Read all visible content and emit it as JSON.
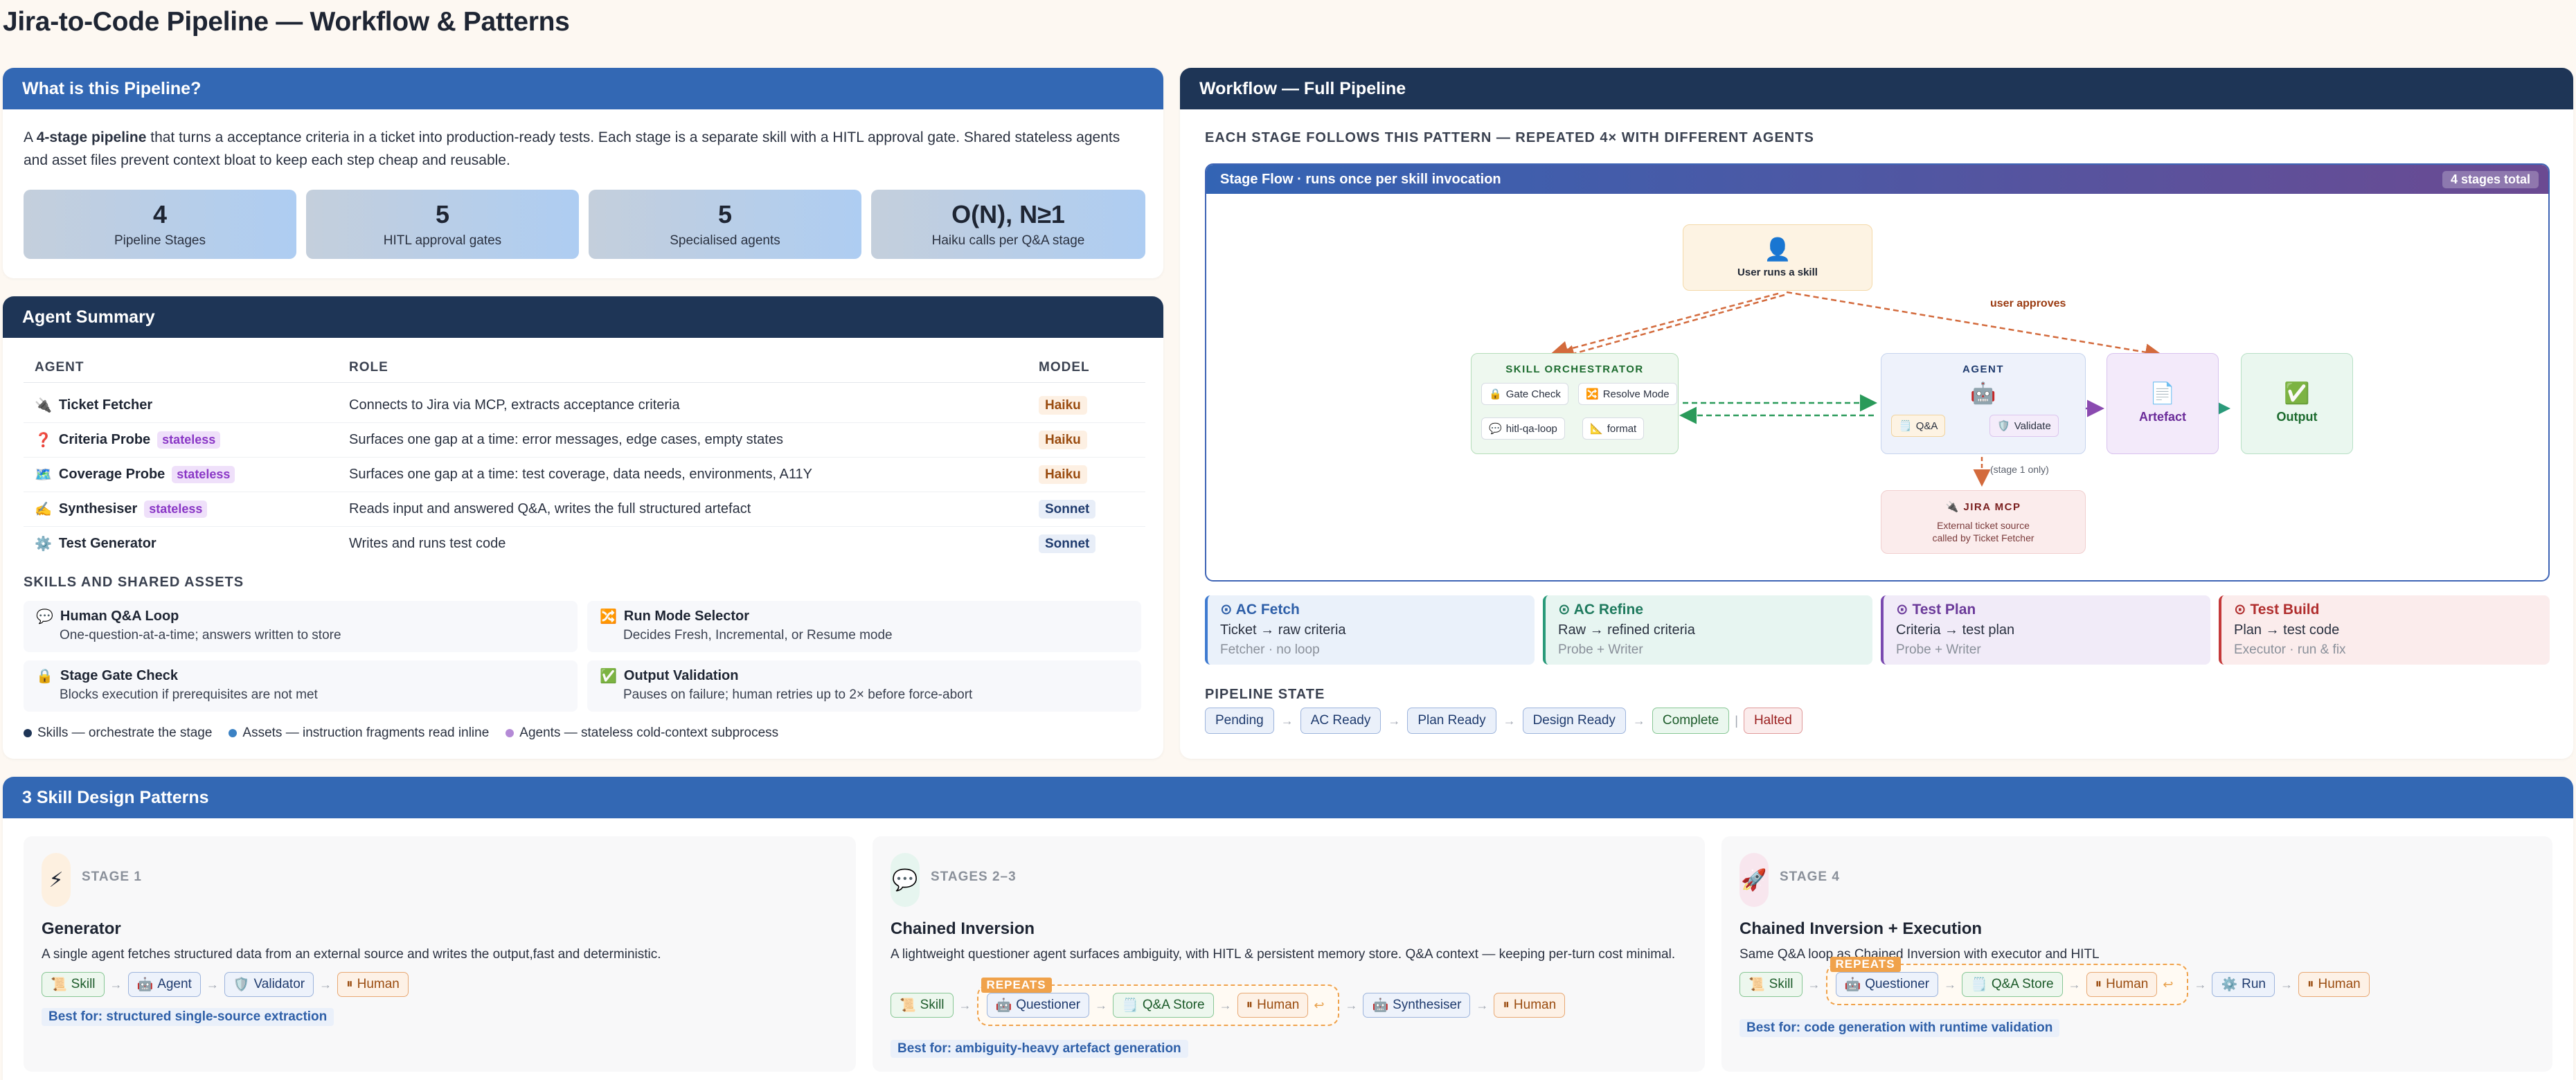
{
  "page_title": "Jira-to-Code Pipeline — Workflow & Patterns",
  "intro": {
    "header": "What is this Pipeline?",
    "lead_pre": "A ",
    "lead_bold": "4-stage pipeline",
    "lead_post": " that turns a acceptance criteria in a ticket into production-ready tests. Each stage is a separate skill with a HITL approval gate. Shared stateless agents and asset files prevent context bloat to keep each step cheap and reusable.",
    "stats": [
      {
        "num": "4",
        "label": "Pipeline Stages"
      },
      {
        "num": "5",
        "label": "HITL approval gates"
      },
      {
        "num": "5",
        "label": "Specialised agents"
      },
      {
        "num": "O(N), N≥1",
        "label": "Haiku calls per Q&A stage"
      }
    ]
  },
  "agents": {
    "header": "Agent Summary",
    "columns": [
      "AGENT",
      "ROLE",
      "MODEL"
    ],
    "rows": [
      {
        "icon": "🔌",
        "name": "Ticket Fetcher",
        "tag": "",
        "role": "Connects to Jira via MCP, extracts acceptance criteria",
        "model": "Haiku"
      },
      {
        "icon": "❓",
        "name": "Criteria Probe",
        "tag": "stateless",
        "role": "Surfaces one gap at a time: error messages, edge cases, empty states",
        "model": "Haiku"
      },
      {
        "icon": "🗺️",
        "name": "Coverage Probe",
        "tag": "stateless",
        "role": "Surfaces one gap at a time: test coverage, data needs, environments, A11Y",
        "model": "Haiku"
      },
      {
        "icon": "✍️",
        "name": "Synthesiser",
        "tag": "stateless",
        "role": "Reads input and answered Q&A, writes the full structured artefact",
        "model": "Sonnet"
      },
      {
        "icon": "⚙️",
        "name": "Test Generator",
        "tag": "",
        "role": "Writes and runs test code",
        "model": "Sonnet"
      }
    ],
    "skills_label": "SKILLS AND SHARED ASSETS",
    "assets": [
      {
        "icon": "💬",
        "title": "Human Q&A Loop",
        "desc": "One-question-at-a-time; answers written to store"
      },
      {
        "icon": "🔀",
        "title": "Run Mode Selector",
        "desc": "Decides Fresh, Incremental, or Resume mode"
      },
      {
        "icon": "🔒",
        "title": "Stage Gate Check",
        "desc": "Blocks execution if prerequisites are not met"
      },
      {
        "icon": "✅",
        "title": "Output Validation",
        "desc": "Pauses on failure; human retries up to 2× before force-abort"
      }
    ],
    "legend": [
      {
        "label": "Skills — orchestrate the stage",
        "color": "#1e3556"
      },
      {
        "label": "Assets — instruction fragments read inline",
        "color": "#3b82c4"
      },
      {
        "label": "Agents — stateless cold-context subprocess",
        "color": "#b48ad6"
      }
    ]
  },
  "workflow": {
    "header": "Workflow — Full Pipeline",
    "sub": "EACH STAGE FOLLOWS THIS PATTERN — REPEATED 4× WITH DIFFERENT AGENTS",
    "flow_title": "Stage Flow  ·  runs once per skill invocation",
    "flow_badge": "4 stages total",
    "user_node": "User runs a skill",
    "user_approves": "user approves",
    "orchestrator": "SKILL ORCHESTRATOR",
    "orch_chips": [
      "Gate Check",
      "Resolve Mode",
      "hitl-qa-loop",
      "format"
    ],
    "agent": "AGENT",
    "agent_chips": [
      "Q&A",
      "Validate"
    ],
    "artefact": "Artefact",
    "output": "Output",
    "stage1_only": "(stage 1 only)",
    "jira_title": "JIRA MCP",
    "jira_desc1": "External ticket source",
    "jira_desc2": "called by Ticket Fetcher",
    "stages": [
      {
        "title": "AC Fetch",
        "a": "Ticket → raw criteria",
        "b": "Fetcher · no loop"
      },
      {
        "title": "AC Refine",
        "a": "Raw → refined criteria",
        "b": "Probe + Writer"
      },
      {
        "title": "Test Plan",
        "a": "Criteria → test plan",
        "b": "Probe + Writer"
      },
      {
        "title": "Test Build",
        "a": "Plan → test code",
        "b": "Executor · run & fix"
      }
    ],
    "state_label": "PIPELINE STATE",
    "states": [
      "Pending",
      "AC Ready",
      "Plan Ready",
      "Design Ready",
      "Complete",
      "Halted"
    ]
  },
  "patterns": {
    "header": "3 Skill Design Patterns",
    "items": [
      {
        "stage": "STAGE 1",
        "title": "Generator",
        "desc": "A single agent fetches structured data from an external source and writes the output,fast and deterministic.",
        "flow": [
          "Skill",
          "Agent",
          "Validator",
          "Human"
        ],
        "best": "Best for: structured single-source extraction"
      },
      {
        "stage": "STAGES 2–3",
        "title": "Chained Inversion",
        "desc": "A lightweight questioner agent surfaces ambiguity, with HITL & persistent memory store. Q&A context — keeping per-turn cost minimal.",
        "flow": [
          "Skill",
          "Questioner",
          "Q&A Store",
          "Human",
          "Synthesiser",
          "Human"
        ],
        "repeats": "REPEATS",
        "best": "Best for: ambiguity-heavy artefact generation"
      },
      {
        "stage": "STAGE 4",
        "title": "Chained Inversion + Execution",
        "desc": "Same Q&A loop as Chained Inversion with executor and HITL",
        "flow": [
          "Skill",
          "Questioner",
          "Q&A Store",
          "Human",
          "Run",
          "Human"
        ],
        "repeats": "REPEATS",
        "best": "Best for: code generation with runtime validation"
      }
    ]
  }
}
